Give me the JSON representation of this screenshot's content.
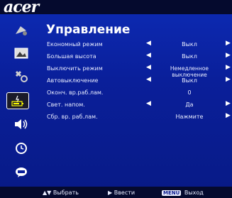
{
  "header": {
    "brand": "acer"
  },
  "page": {
    "title": "Управление"
  },
  "sidebar": {
    "items": [
      {
        "icon": "color-icon"
      },
      {
        "icon": "image-icon"
      },
      {
        "icon": "settings-icon"
      },
      {
        "icon": "lamp-battery-icon",
        "active": true
      },
      {
        "icon": "audio-icon"
      },
      {
        "icon": "timer-icon"
      },
      {
        "icon": "language-icon"
      }
    ]
  },
  "menu": {
    "rows": [
      {
        "label": "Економный режим",
        "value": "Выкл",
        "left_arrow": "◀",
        "right_arrow": "▶"
      },
      {
        "label": "Большая высота",
        "value": "Выкл",
        "left_arrow": "◀",
        "right_arrow": "▶"
      },
      {
        "label": "Выключить режим",
        "value": "Немедленное выключение",
        "left_arrow": "◀",
        "right_arrow": "▶"
      },
      {
        "label": "Автовыключение",
        "value": "Выкл",
        "left_arrow": "◀",
        "right_arrow": "▶"
      },
      {
        "label": "Оконч. вр.раб.лам.",
        "value": "0",
        "left_arrow": "",
        "right_arrow": ""
      },
      {
        "label": "Свет. напом.",
        "value": "Да",
        "left_arrow": "◀",
        "right_arrow": "▶"
      },
      {
        "label": "Сбр. вр. раб.лам.",
        "value": "Нажмите",
        "left_arrow": "",
        "right_arrow": "▶"
      }
    ]
  },
  "footer": {
    "select_symbol": "▲▼",
    "select_label": "Выбрать",
    "enter_symbol": "▶",
    "enter_label": "Ввести",
    "menu_key": "MENU",
    "exit_label": "Выход"
  },
  "colors": {
    "background": "#0a1f9a",
    "bar": "#050a2e",
    "text": "#e8ecff"
  }
}
